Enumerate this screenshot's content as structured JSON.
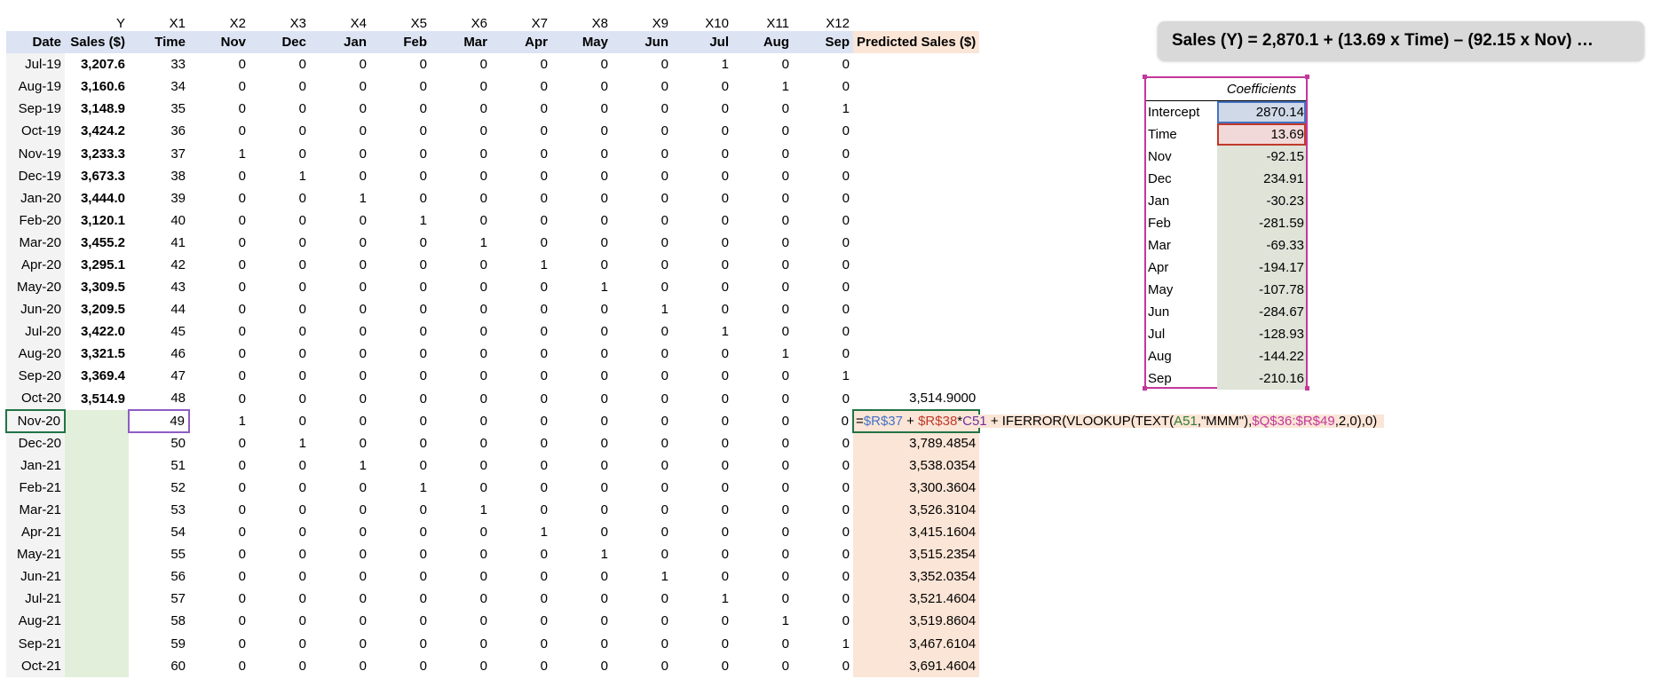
{
  "col_letters": [
    "",
    "Y",
    "X1",
    "X2",
    "X3",
    "X4",
    "X5",
    "X6",
    "X7",
    "X8",
    "X9",
    "X10",
    "X11",
    "X12",
    ""
  ],
  "headers": [
    "Date",
    "Sales ($)",
    "Time",
    "Nov",
    "Dec",
    "Jan",
    "Feb",
    "Mar",
    "Apr",
    "May",
    "Jun",
    "Jul",
    "Aug",
    "Sep",
    "Predicted Sales ($)"
  ],
  "rows": [
    {
      "date": "Jul-19",
      "sales": "3,207.6",
      "time": "33",
      "dummies": [
        "0",
        "0",
        "0",
        "0",
        "0",
        "0",
        "0",
        "0",
        "1",
        "0",
        "0"
      ],
      "pred": ""
    },
    {
      "date": "Aug-19",
      "sales": "3,160.6",
      "time": "34",
      "dummies": [
        "0",
        "0",
        "0",
        "0",
        "0",
        "0",
        "0",
        "0",
        "0",
        "1",
        "0"
      ],
      "pred": ""
    },
    {
      "date": "Sep-19",
      "sales": "3,148.9",
      "time": "35",
      "dummies": [
        "0",
        "0",
        "0",
        "0",
        "0",
        "0",
        "0",
        "0",
        "0",
        "0",
        "1"
      ],
      "pred": ""
    },
    {
      "date": "Oct-19",
      "sales": "3,424.2",
      "time": "36",
      "dummies": [
        "0",
        "0",
        "0",
        "0",
        "0",
        "0",
        "0",
        "0",
        "0",
        "0",
        "0"
      ],
      "pred": ""
    },
    {
      "date": "Nov-19",
      "sales": "3,233.3",
      "time": "37",
      "dummies": [
        "1",
        "0",
        "0",
        "0",
        "0",
        "0",
        "0",
        "0",
        "0",
        "0",
        "0"
      ],
      "pred": ""
    },
    {
      "date": "Dec-19",
      "sales": "3,673.3",
      "time": "38",
      "dummies": [
        "0",
        "1",
        "0",
        "0",
        "0",
        "0",
        "0",
        "0",
        "0",
        "0",
        "0"
      ],
      "pred": ""
    },
    {
      "date": "Jan-20",
      "sales": "3,444.0",
      "time": "39",
      "dummies": [
        "0",
        "0",
        "1",
        "0",
        "0",
        "0",
        "0",
        "0",
        "0",
        "0",
        "0"
      ],
      "pred": ""
    },
    {
      "date": "Feb-20",
      "sales": "3,120.1",
      "time": "40",
      "dummies": [
        "0",
        "0",
        "0",
        "1",
        "0",
        "0",
        "0",
        "0",
        "0",
        "0",
        "0"
      ],
      "pred": ""
    },
    {
      "date": "Mar-20",
      "sales": "3,455.2",
      "time": "41",
      "dummies": [
        "0",
        "0",
        "0",
        "0",
        "1",
        "0",
        "0",
        "0",
        "0",
        "0",
        "0"
      ],
      "pred": ""
    },
    {
      "date": "Apr-20",
      "sales": "3,295.1",
      "time": "42",
      "dummies": [
        "0",
        "0",
        "0",
        "0",
        "0",
        "1",
        "0",
        "0",
        "0",
        "0",
        "0"
      ],
      "pred": ""
    },
    {
      "date": "May-20",
      "sales": "3,309.5",
      "time": "43",
      "dummies": [
        "0",
        "0",
        "0",
        "0",
        "0",
        "0",
        "1",
        "0",
        "0",
        "0",
        "0"
      ],
      "pred": ""
    },
    {
      "date": "Jun-20",
      "sales": "3,209.5",
      "time": "44",
      "dummies": [
        "0",
        "0",
        "0",
        "0",
        "0",
        "0",
        "0",
        "1",
        "0",
        "0",
        "0"
      ],
      "pred": ""
    },
    {
      "date": "Jul-20",
      "sales": "3,422.0",
      "time": "45",
      "dummies": [
        "0",
        "0",
        "0",
        "0",
        "0",
        "0",
        "0",
        "0",
        "1",
        "0",
        "0"
      ],
      "pred": ""
    },
    {
      "date": "Aug-20",
      "sales": "3,321.5",
      "time": "46",
      "dummies": [
        "0",
        "0",
        "0",
        "0",
        "0",
        "0",
        "0",
        "0",
        "0",
        "1",
        "0"
      ],
      "pred": ""
    },
    {
      "date": "Sep-20",
      "sales": "3,369.4",
      "time": "47",
      "dummies": [
        "0",
        "0",
        "0",
        "0",
        "0",
        "0",
        "0",
        "0",
        "0",
        "0",
        "1"
      ],
      "pred": ""
    },
    {
      "date": "Oct-20",
      "sales": "3,514.9",
      "time": "48",
      "dummies": [
        "0",
        "0",
        "0",
        "0",
        "0",
        "0",
        "0",
        "0",
        "0",
        "0",
        "0"
      ],
      "pred": "3,514.9000"
    },
    {
      "date": "Nov-20",
      "sales": "",
      "time": "49",
      "dummies": [
        "1",
        "0",
        "0",
        "0",
        "0",
        "0",
        "0",
        "0",
        "0",
        "0",
        "0"
      ],
      "pred": "",
      "editing": true
    },
    {
      "date": "Dec-20",
      "sales": "",
      "time": "50",
      "dummies": [
        "0",
        "1",
        "0",
        "0",
        "0",
        "0",
        "0",
        "0",
        "0",
        "0",
        "0"
      ],
      "pred": "3,789.4854"
    },
    {
      "date": "Jan-21",
      "sales": "",
      "time": "51",
      "dummies": [
        "0",
        "0",
        "1",
        "0",
        "0",
        "0",
        "0",
        "0",
        "0",
        "0",
        "0"
      ],
      "pred": "3,538.0354"
    },
    {
      "date": "Feb-21",
      "sales": "",
      "time": "52",
      "dummies": [
        "0",
        "0",
        "0",
        "1",
        "0",
        "0",
        "0",
        "0",
        "0",
        "0",
        "0"
      ],
      "pred": "3,300.3604"
    },
    {
      "date": "Mar-21",
      "sales": "",
      "time": "53",
      "dummies": [
        "0",
        "0",
        "0",
        "0",
        "1",
        "0",
        "0",
        "0",
        "0",
        "0",
        "0"
      ],
      "pred": "3,526.3104"
    },
    {
      "date": "Apr-21",
      "sales": "",
      "time": "54",
      "dummies": [
        "0",
        "0",
        "0",
        "0",
        "0",
        "1",
        "0",
        "0",
        "0",
        "0",
        "0"
      ],
      "pred": "3,415.1604"
    },
    {
      "date": "May-21",
      "sales": "",
      "time": "55",
      "dummies": [
        "0",
        "0",
        "0",
        "0",
        "0",
        "0",
        "1",
        "0",
        "0",
        "0",
        "0"
      ],
      "pred": "3,515.2354"
    },
    {
      "date": "Jun-21",
      "sales": "",
      "time": "56",
      "dummies": [
        "0",
        "0",
        "0",
        "0",
        "0",
        "0",
        "0",
        "1",
        "0",
        "0",
        "0"
      ],
      "pred": "3,352.0354"
    },
    {
      "date": "Jul-21",
      "sales": "",
      "time": "57",
      "dummies": [
        "0",
        "0",
        "0",
        "0",
        "0",
        "0",
        "0",
        "0",
        "1",
        "0",
        "0"
      ],
      "pred": "3,521.4604"
    },
    {
      "date": "Aug-21",
      "sales": "",
      "time": "58",
      "dummies": [
        "0",
        "0",
        "0",
        "0",
        "0",
        "0",
        "0",
        "0",
        "0",
        "1",
        "0"
      ],
      "pred": "3,519.8604"
    },
    {
      "date": "Sep-21",
      "sales": "",
      "time": "59",
      "dummies": [
        "0",
        "0",
        "0",
        "0",
        "0",
        "0",
        "0",
        "0",
        "0",
        "0",
        "1"
      ],
      "pred": "3,467.6104"
    },
    {
      "date": "Oct-21",
      "sales": "",
      "time": "60",
      "dummies": [
        "0",
        "0",
        "0",
        "0",
        "0",
        "0",
        "0",
        "0",
        "0",
        "0",
        "0"
      ],
      "pred": "3,691.4604"
    }
  ],
  "formula": {
    "eq": "=",
    "ref_intercept": "$R$37",
    "plus1": " + ",
    "ref_time": "$R$38",
    "times": "*",
    "ref_cell": "C51",
    "mid": " + IFERROR(VLOOKUP(TEXT(",
    "ref_date": "A51",
    "fmt": ",\"MMM\"),",
    "ref_range": "$Q$36:$R$49",
    "tail": ",2,0),0)"
  },
  "banner": "Sales (Y) = 2,870.1 + (13.69 x Time) – (92.15 x Nov) …",
  "coefficients": {
    "header": "Coefficients",
    "items": [
      {
        "name": "Intercept",
        "value": "2870.14"
      },
      {
        "name": "Time",
        "value": "13.69"
      },
      {
        "name": "Nov",
        "value": "-92.15"
      },
      {
        "name": "Dec",
        "value": "234.91"
      },
      {
        "name": "Jan",
        "value": "-30.23"
      },
      {
        "name": "Feb",
        "value": "-281.59"
      },
      {
        "name": "Mar",
        "value": "-69.33"
      },
      {
        "name": "Apr",
        "value": "-194.17"
      },
      {
        "name": "May",
        "value": "-107.78"
      },
      {
        "name": "Jun",
        "value": "-284.67"
      },
      {
        "name": "Jul",
        "value": "-128.93"
      },
      {
        "name": "Aug",
        "value": "-144.22"
      },
      {
        "name": "Sep",
        "value": "-210.16"
      }
    ]
  },
  "colors": {
    "header_fill": "#dce3f3",
    "pred_fill": "#fbe5d6",
    "forecast_sales_fill": "#e2efda",
    "selection_green": "#217346",
    "coef_border": "#c2389b"
  }
}
